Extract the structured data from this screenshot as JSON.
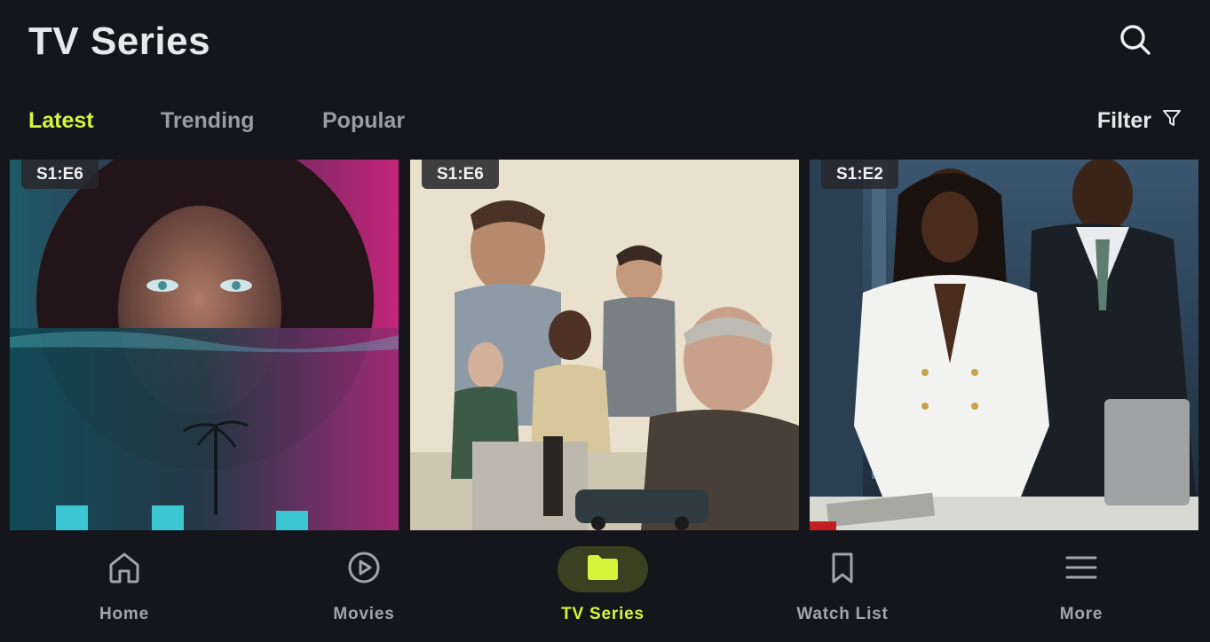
{
  "header": {
    "title": "TV Series",
    "search_icon": "search-icon"
  },
  "tabs": [
    {
      "label": "Latest",
      "active": true
    },
    {
      "label": "Trending",
      "active": false
    },
    {
      "label": "Popular",
      "active": false
    }
  ],
  "filter": {
    "label": "Filter",
    "icon": "filter-icon"
  },
  "cards": [
    {
      "episode": "S1:E6"
    },
    {
      "episode": "S1:E6"
    },
    {
      "episode": "S1:E2"
    }
  ],
  "bottom_nav": [
    {
      "label": "Home",
      "icon": "home-icon",
      "active": false
    },
    {
      "label": "Movies",
      "icon": "play-circle-icon",
      "active": false
    },
    {
      "label": "TV Series",
      "icon": "folder-icon",
      "active": true
    },
    {
      "label": "Watch List",
      "icon": "bookmark-icon",
      "active": false
    },
    {
      "label": "More",
      "icon": "menu-icon",
      "active": false
    }
  ],
  "colors": {
    "background": "#15161c",
    "accent": "#d6f53a",
    "inactive": "#9a9ba3"
  }
}
